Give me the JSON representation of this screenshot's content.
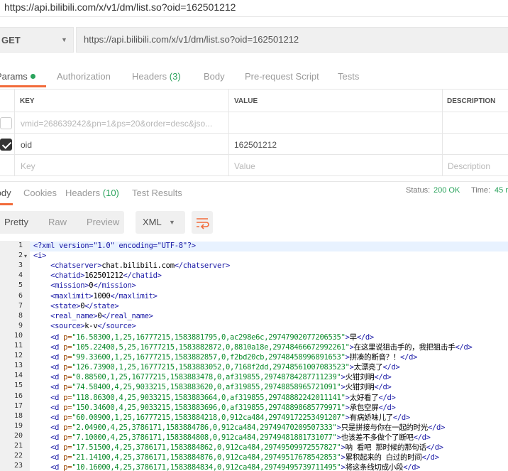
{
  "window_title": "https://api.bilibili.com/x/v1/dm/list.so?oid=162501212",
  "request": {
    "method": "GET",
    "url": "https://api.bilibili.com/x/v1/dm/list.so?oid=162501212"
  },
  "request_tabs": {
    "params": "Params",
    "authorization": "Authorization",
    "headers": "Headers",
    "headers_count": "(3)",
    "body": "Body",
    "prerequest": "Pre-request Script",
    "tests": "Tests"
  },
  "params_table": {
    "col_key": "KEY",
    "col_value": "VALUE",
    "col_description": "DESCRIPTION",
    "rows": [
      {
        "key": "vmid=268639242&pn=1&ps=20&order=desc&jso...",
        "value": "",
        "checked": false
      },
      {
        "key": "oid",
        "value": "162501212",
        "checked": true
      }
    ],
    "placeholder_key": "Key",
    "placeholder_value": "Value",
    "placeholder_description": "Description"
  },
  "response_tabs": {
    "body": "Body",
    "cookies": "Cookies",
    "headers": "Headers",
    "headers_count": "(10)",
    "test_results": "Test Results"
  },
  "status": {
    "status_label": "Status:",
    "status_value": "200 OK",
    "time_label": "Time:",
    "time_value": "45 m"
  },
  "toolbar": {
    "pretty": "Pretty",
    "raw": "Raw",
    "preview": "Preview",
    "format": "XML",
    "wrap_icon": "wrap-lines-icon"
  },
  "colors": {
    "accent": "#f26b3a",
    "success": "#2aa35c",
    "tag": "#1a1aa6",
    "attr": "#994500",
    "string": "#0a8a2a"
  },
  "code_lines": [
    {
      "n": "1",
      "t": "decl",
      "text": "<?xml version=\"1.0\" encoding=\"UTF-8\"?>"
    },
    {
      "n": "2",
      "t": "open",
      "text": "<i>"
    },
    {
      "n": "3",
      "t": "el",
      "tag": "chatserver",
      "val": "chat.bilibili.com"
    },
    {
      "n": "4",
      "t": "el",
      "tag": "chatid",
      "val": "162501212"
    },
    {
      "n": "5",
      "t": "el",
      "tag": "mission",
      "val": "0"
    },
    {
      "n": "6",
      "t": "el",
      "tag": "maxlimit",
      "val": "1000"
    },
    {
      "n": "7",
      "t": "el",
      "tag": "state",
      "val": "0"
    },
    {
      "n": "8",
      "t": "el",
      "tag": "real_name",
      "val": "0"
    },
    {
      "n": "9",
      "t": "el",
      "tag": "source",
      "val": "k-v"
    },
    {
      "n": "10",
      "t": "d",
      "p": "16.58300,1,25,16777215,1583881795,0,ac298e6c,29747902077206535",
      "val": "早"
    },
    {
      "n": "11",
      "t": "d",
      "p": "105.22400,5,25,16777215,1583882872,0,8810a18e,29748466672992261",
      "val": "在这里说狙击手的，我把狙击手"
    },
    {
      "n": "12",
      "t": "d",
      "p": "99.33600,1,25,16777215,1583882857,0,f2bd20cb,29748458996891653",
      "val": "拼凑的断音？！"
    },
    {
      "n": "13",
      "t": "d",
      "p": "126.73900,1,25,16777215,1583883052,0,7168f2dd,29748561007083523",
      "val": "太漂亮了"
    },
    {
      "n": "14",
      "t": "d",
      "p": "0.88500,1,25,16777215,1583883478,0,af319855,29748784287711239",
      "val": "火钳刘明"
    },
    {
      "n": "15",
      "t": "d",
      "p": "74.58400,4,25,9033215,1583883620,0,af319855,29748858965721091",
      "val": "火钳刘明"
    },
    {
      "n": "16",
      "t": "d",
      "p": "118.86300,4,25,9033215,1583883664,0,af319855,29748882242011141",
      "val": "太好看了"
    },
    {
      "n": "17",
      "t": "d",
      "p": "150.34600,4,25,9033215,1583883696,0,af319855,29748898685779971",
      "val": "承包空屏"
    },
    {
      "n": "18",
      "t": "d",
      "p": "60.00900,1,25,16777215,1583884218,0,912ca484,29749172253491207",
      "val": "有病娇味儿了"
    },
    {
      "n": "19",
      "t": "d",
      "p": "2.04900,4,25,3786171,1583884786,0,912ca484,29749470209507333",
      "val": "只是拼接与你在一起的时光"
    },
    {
      "n": "20",
      "t": "d",
      "p": "7.10000,4,25,3786171,1583884808,0,912ca484,29749481881731077",
      "val": "也该差不多做个了断吧"
    },
    {
      "n": "21",
      "t": "d",
      "p": "17.51500,4,25,3786171,1583884862,0,912ca484,29749509972557827",
      "val": "呐 看吧 那时候的那句话"
    },
    {
      "n": "22",
      "t": "d",
      "p": "21.14100,4,25,3786171,1583884876,0,912ca484,29749517678542853",
      "val": "累积起来的 白过的时间"
    },
    {
      "n": "23",
      "t": "d",
      "p": "10.16000,4,25,3786171,1583884834,0,912ca484,29749495739711495",
      "val": "将这条线切成小段"
    }
  ]
}
